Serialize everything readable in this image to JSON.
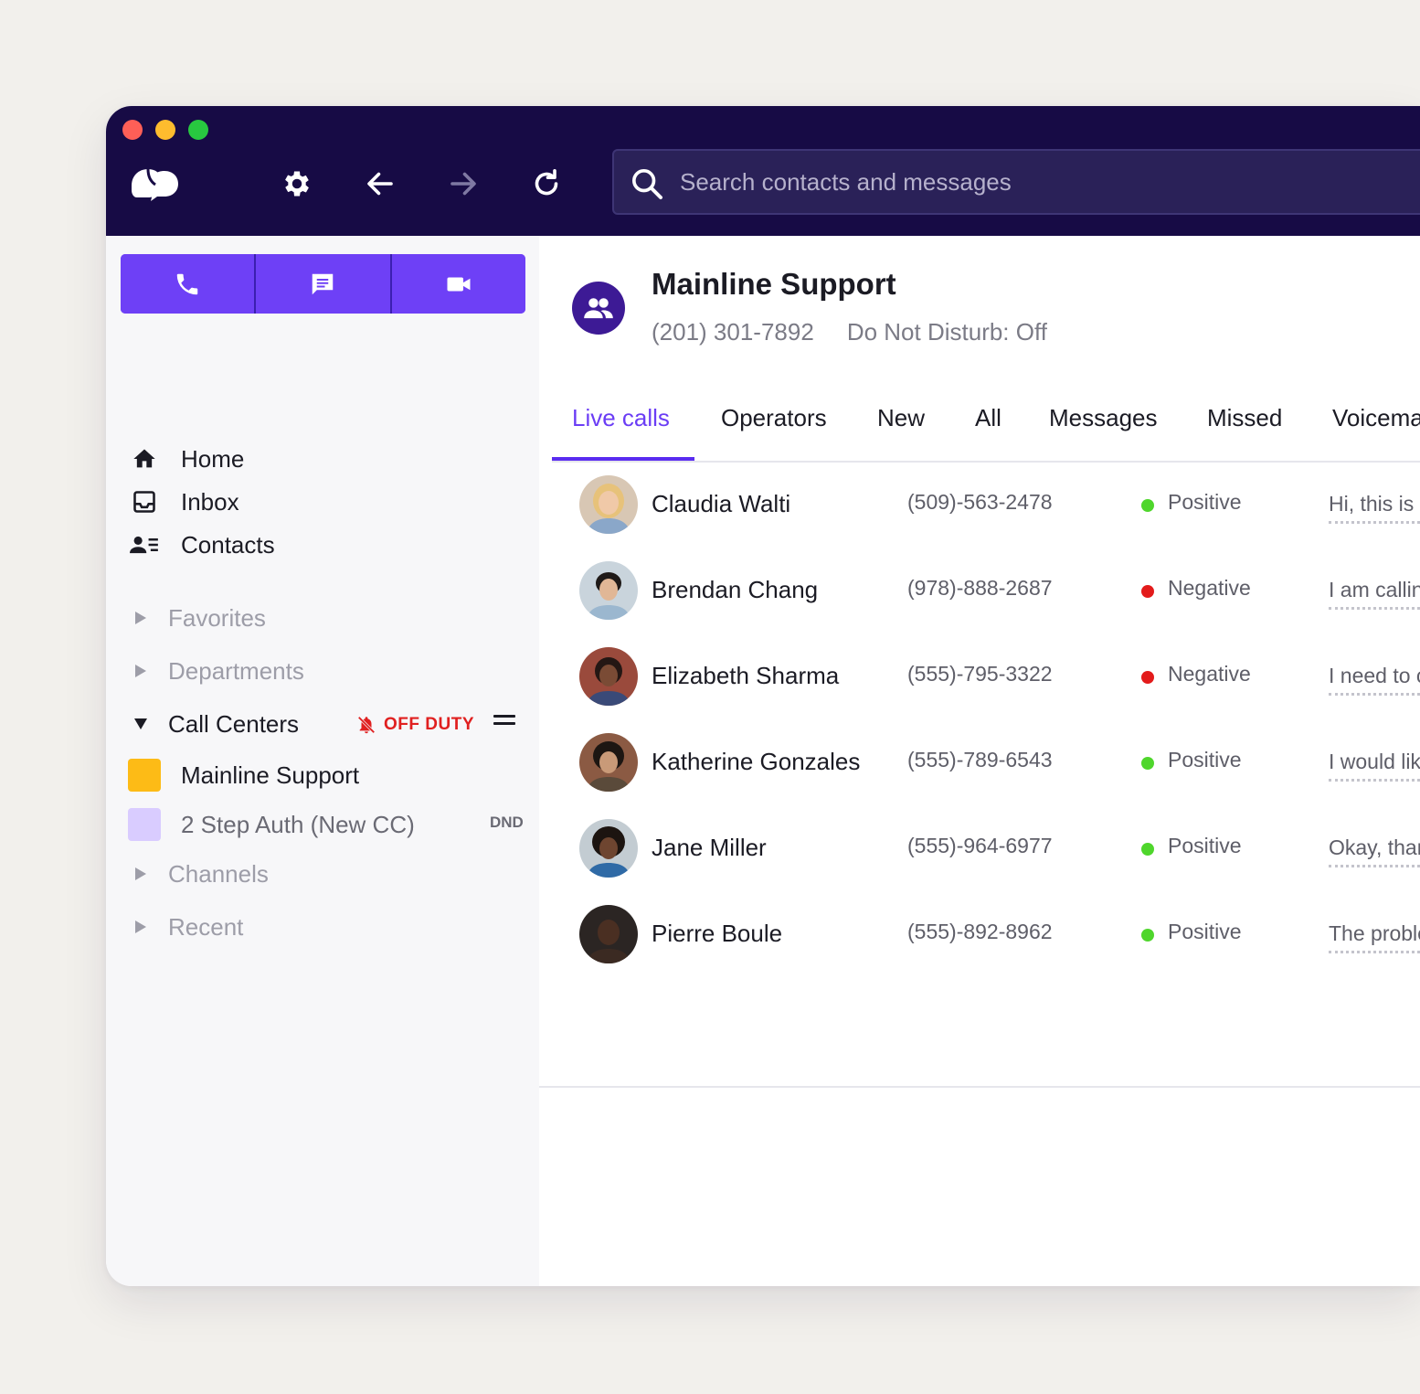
{
  "topbar": {
    "logo_icon": "dialpad-logo",
    "buttons": [
      "gear-icon",
      "arrow-left-icon",
      "arrow-right-icon",
      "refresh-icon"
    ],
    "search_placeholder": "Search contacts and messages"
  },
  "sidebar": {
    "actions": [
      "phone-icon",
      "message-icon",
      "video-icon"
    ],
    "nav": [
      {
        "label": "Home",
        "icon": "home-icon"
      },
      {
        "label": "Inbox",
        "icon": "inbox-icon"
      },
      {
        "label": "Contacts",
        "icon": "contacts-icon"
      }
    ],
    "sections": {
      "favorites": "Favorites",
      "departments": "Departments",
      "call_centers": "Call Centers",
      "channels": "Channels",
      "recent": "Recent"
    },
    "off_duty": "OFF DUTY",
    "call_centers": [
      {
        "label": "Mainline Support",
        "color": "#fdbb16"
      },
      {
        "label": "2 Step Auth (New CC)",
        "color": "#d9ccff",
        "badge": "DND"
      }
    ]
  },
  "header": {
    "title": "Mainline Support",
    "phone": "(201) 301-7892",
    "dnd_status": "Do Not Disturb: Off"
  },
  "tabs": [
    "Live calls",
    "Operators",
    "New",
    "All",
    "Messages",
    "Missed",
    "Voicema"
  ],
  "active_tab": "Live calls",
  "calls": [
    {
      "name": "Claudia Walti",
      "phone": "(509)-563-2478",
      "sentiment": "Positive",
      "message": "Hi, this is I"
    },
    {
      "name": "Brendan Chang",
      "phone": "(978)-888-2687",
      "sentiment": "Negative",
      "message": "I am callin"
    },
    {
      "name": "Elizabeth Sharma",
      "phone": "(555)-795-3322",
      "sentiment": "Negative",
      "message": "I need to c"
    },
    {
      "name": "Katherine Gonzales",
      "phone": "(555)-789-6543",
      "sentiment": "Positive",
      "message": "I would lik"
    },
    {
      "name": "Jane Miller",
      "phone": "(555)-964-6977",
      "sentiment": "Positive",
      "message": "Okay, than"
    },
    {
      "name": "Pierre Boule",
      "phone": "(555)-892-8962",
      "sentiment": "Positive",
      "message": "The proble"
    }
  ],
  "colors": {
    "titlebar": "#170b45",
    "accent": "#6b3df5",
    "positive": "#4fd62c",
    "negative": "#e31b1b",
    "off_duty": "#e02020"
  }
}
